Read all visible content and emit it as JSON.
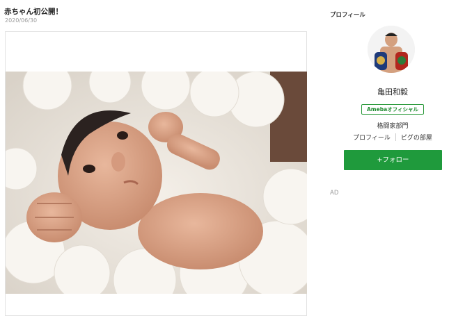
{
  "article": {
    "title": "赤ちゃん初公開！",
    "date": "2020/06/30",
    "image": "newborn-baby-photo"
  },
  "sidebar": {
    "heading": "プロフィール",
    "avatar": "boxer-avatar",
    "name": "亀田和毅",
    "badge": "Amebaオフィシャル",
    "category": "格闘家部門",
    "links": [
      "プロフィール",
      "ピグの部屋"
    ],
    "follow_label": "+フォロー",
    "ad_label": "AD"
  },
  "colors": {
    "brand_green": "#1f9a3c",
    "badge_green": "#2a9a3a"
  }
}
